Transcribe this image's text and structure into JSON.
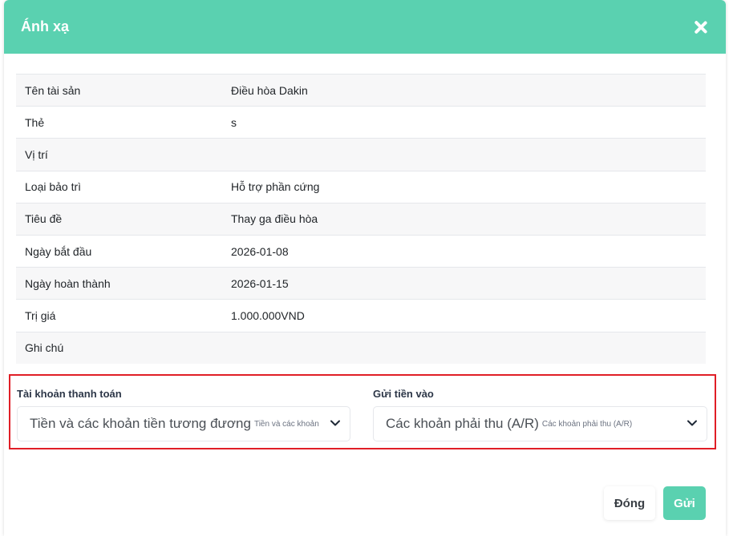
{
  "modal": {
    "title": "Ánh xạ",
    "rows": [
      {
        "label": "Tên tài sản",
        "value": "Điều hòa Dakin"
      },
      {
        "label": "Thẻ",
        "value": "s"
      },
      {
        "label": "Vị trí",
        "value": ""
      },
      {
        "label": "Loại bảo trì",
        "value": "Hỗ trợ phần cứng"
      },
      {
        "label": "Tiêu đề",
        "value": "Thay ga điều hòa"
      },
      {
        "label": "Ngày bắt đầu",
        "value": "2026-01-08"
      },
      {
        "label": "Ngày hoàn thành",
        "value": "2026-01-15"
      },
      {
        "label": "Trị giá",
        "value": "1.000.000VND"
      },
      {
        "label": "Ghi chú",
        "value": ""
      }
    ],
    "payment_account": {
      "label": "Tài khoản thanh toán",
      "selected": "Tiền và các khoản tiền tương đương",
      "selected_sub": "Tiền và các khoản"
    },
    "deposit_to": {
      "label": "Gửi tiền vào",
      "selected": "Các khoản phải thu (A/R)",
      "selected_sub": "Các khoản phải thu (A/R)"
    },
    "buttons": {
      "close": "Đóng",
      "submit": "Gửi"
    },
    "colors": {
      "header": "#5ad1b0",
      "highlight": "#e01e26"
    }
  }
}
